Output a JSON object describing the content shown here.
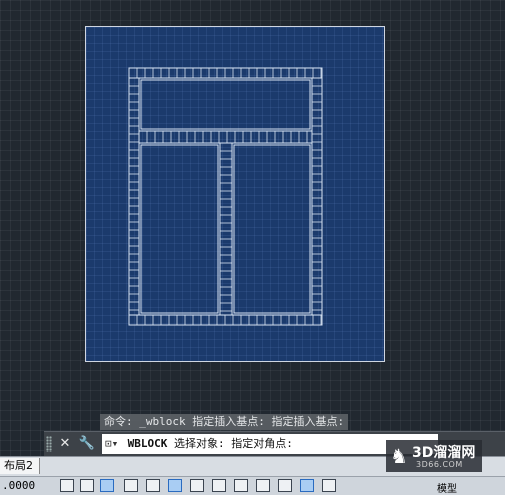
{
  "command_history": "命令: _wblock 指定插入基点: 指定插入基点:",
  "command_line": {
    "prompt_name": "WBLOCK",
    "prompt_text": " 选择对象: 指定对角点:",
    "close_icon": "close-icon",
    "settings_icon": "wrench-icon",
    "recent_commands_icon": "command-history-icon"
  },
  "layout_tab": "布局2",
  "status_bar": {
    "coordinate": ".0000",
    "model_label": "模型",
    "icons": [
      "snap-icon",
      "grid-icon",
      "ortho-icon",
      "polar-icon",
      "osnap-icon",
      "otrack-icon",
      "ducs-icon",
      "dyn-icon",
      "lineweight-icon",
      "transparency-icon",
      "selection-cycling-icon",
      "annotation-monitor-icon",
      "add-icon"
    ]
  },
  "watermark": {
    "name": "3D溜溜网",
    "url": "3D66.COM"
  },
  "colors": {
    "canvas": "#212830",
    "sheet": "#1b3a6c",
    "linework": "#d7e3f2"
  }
}
